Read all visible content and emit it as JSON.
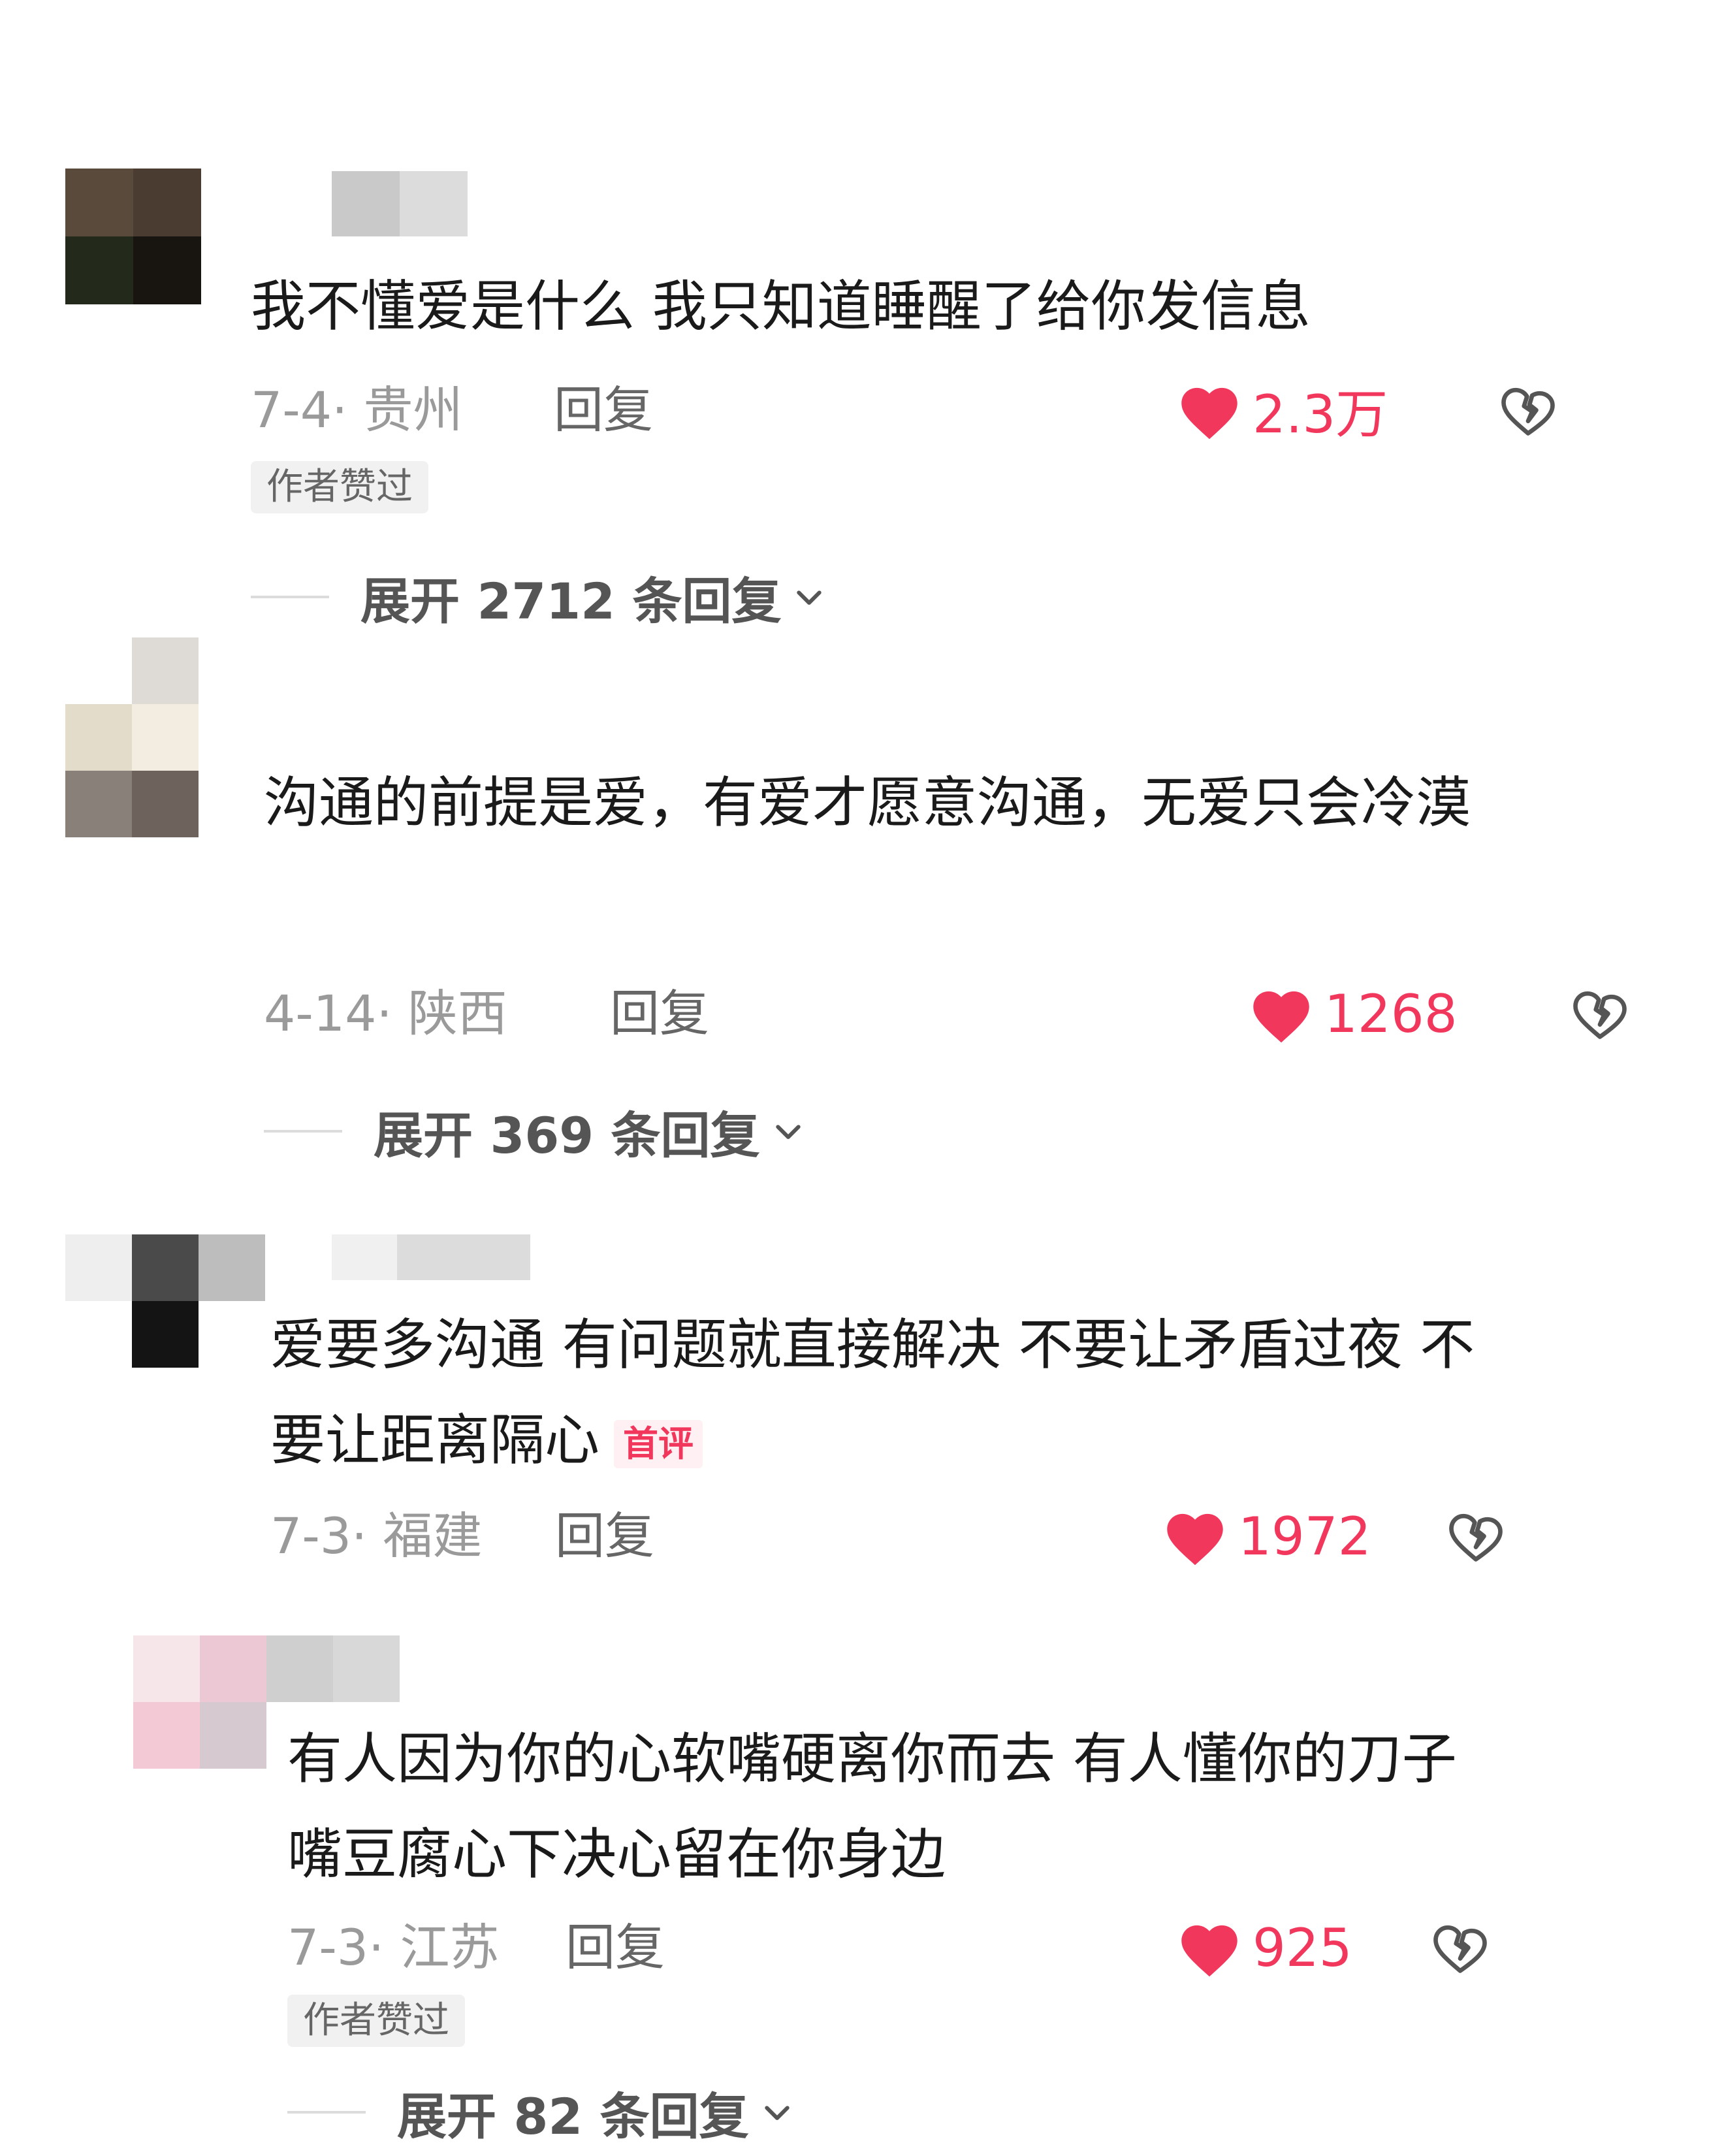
{
  "comments": [
    {
      "text": "我不懂爱是什么 我只知道睡醒了给你发信息",
      "meta": "7-4· 贵州",
      "reply": "回复",
      "likes": "2.3万",
      "badge": "作者赞过",
      "expand": "展开 2712 条回复"
    },
    {
      "text": "沟通的前提是爱，有爱才愿意沟通，无爱只会冷漠",
      "meta": "4-14· 陕西",
      "reply": "回复",
      "likes": "1268",
      "expand": "展开 369 条回复"
    },
    {
      "text": "爱要多沟通 有问题就直接解决 不要让矛盾过夜 不要让距离隔心",
      "tag": "首评",
      "meta": "7-3· 福建",
      "reply": "回复",
      "likes": "1972"
    },
    {
      "text": "有人因为你的心软嘴硬离你而去 有人懂你的刀子嘴豆腐心下决心留在你身边",
      "meta": "7-3· 江苏",
      "reply": "回复",
      "likes": "925",
      "badge": "作者赞过",
      "expand": "展开 82 条回复"
    }
  ],
  "icons": {
    "like": "heart-icon",
    "dislike": "broken-heart-icon",
    "expand": "chevron-down-icon"
  },
  "colors": {
    "accent": "#f2375d",
    "meta": "#9a9a9a",
    "text": "#1a1a1a"
  }
}
